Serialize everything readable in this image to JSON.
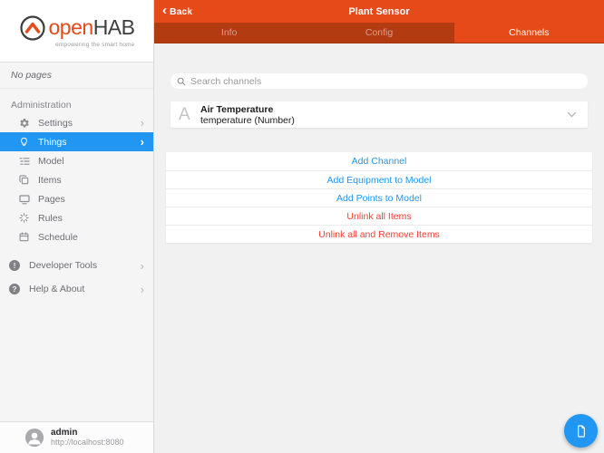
{
  "colors": {
    "accent_orange": "#e64a19",
    "tabbar_dark": "#b23b12",
    "selection_blue": "#2196f3",
    "link_blue": "#2196f3",
    "danger_red": "#ff3b30"
  },
  "icons": {
    "back_chevron": "‹",
    "chevron_right": "›"
  },
  "logo": {
    "open": "open",
    "hab": "HAB",
    "tagline": "empowering the smart home"
  },
  "navbar": {
    "back": "Back",
    "title": "Plant Sensor"
  },
  "tabs": [
    {
      "label": "Info",
      "active": false
    },
    {
      "label": "Config",
      "active": false
    },
    {
      "label": "Channels",
      "active": true
    }
  ],
  "sidebar": {
    "no_pages": "No pages",
    "section": "Administration",
    "items": [
      {
        "label": "Settings",
        "icon": "gear-icon",
        "chevron": true,
        "active": false
      },
      {
        "label": "Things",
        "icon": "lightbulb-icon",
        "chevron": true,
        "active": true
      },
      {
        "label": "Model",
        "icon": "model-tree-icon",
        "chevron": false,
        "active": false
      },
      {
        "label": "Items",
        "icon": "overlapping-squares-icon",
        "chevron": false,
        "active": false
      },
      {
        "label": "Pages",
        "icon": "monitor-icon",
        "chevron": false,
        "active": false
      },
      {
        "label": "Rules",
        "icon": "sparkle-icon",
        "chevron": false,
        "active": false
      },
      {
        "label": "Schedule",
        "icon": "calendar-icon",
        "chevron": false,
        "active": false
      }
    ],
    "secondary": [
      {
        "label": "Developer Tools",
        "icon": "exclamation-circle-icon",
        "glyph": "!",
        "chevron": true
      },
      {
        "label": "Help & About",
        "icon": "question-circle-icon",
        "glyph": "?",
        "chevron": true
      }
    ],
    "user": {
      "name": "admin",
      "url": "http://localhost:8080"
    }
  },
  "content": {
    "search_placeholder": "Search channels",
    "channel": {
      "badge": "A",
      "title": "Air Temperature",
      "subtitle": "temperature (Number)"
    },
    "actions": [
      {
        "label": "Add Channel",
        "style": "link"
      },
      {
        "label": "Add Equipment to Model",
        "style": "link"
      },
      {
        "label": "Add Points to Model",
        "style": "link"
      },
      {
        "label": "Unlink all Items",
        "style": "danger"
      },
      {
        "label": "Unlink all and Remove Items",
        "style": "danger"
      }
    ]
  }
}
